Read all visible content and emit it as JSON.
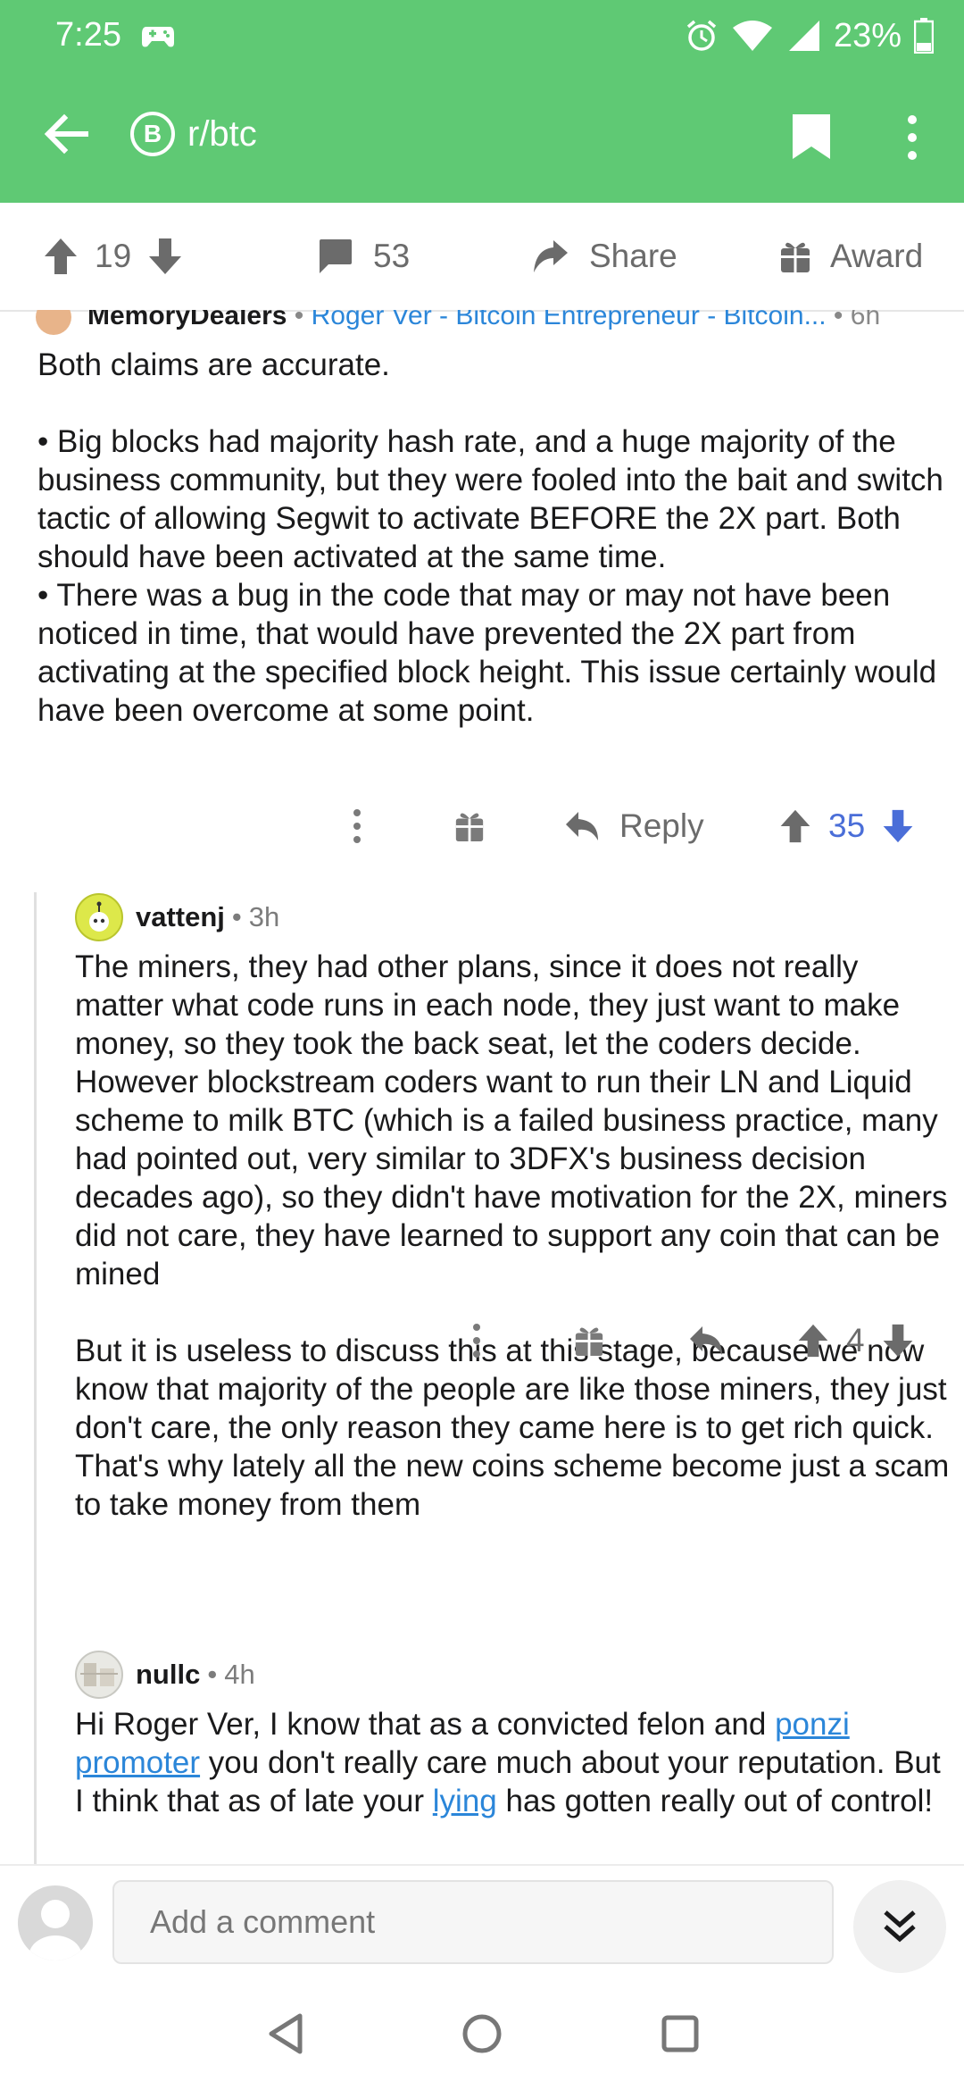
{
  "status_bar": {
    "time": "7:25",
    "battery": "23%"
  },
  "app_bar": {
    "subreddit": "r/btc",
    "subreddit_icon_letter": "B",
    "brand_color": "#5fc974"
  },
  "vote_bar": {
    "score": "19",
    "comments": "53",
    "share_label": "Share",
    "award_label": "Award"
  },
  "comment_parent": {
    "author": "MemoryDealers",
    "flair": "Roger Ver - Bitcoin Entrepreneur - Bitcoin...",
    "age": "6h",
    "paragraphs": [
      "Both claims are accurate.",
      "• Big blocks had majority hash rate, and a huge majority of the business community, but they were fooled into the bait and switch tactic of allowing Segwit to activate BEFORE the 2X part.  Both should have been activated at the same time.",
      "• There was a bug in the code that may or may not have been noticed in time, that would have prevented the 2X part from activating at the specified block height.  This issue certainly would have been overcome at some point."
    ],
    "reply_label": "Reply",
    "score": "35"
  },
  "comment_vattenj": {
    "author": "vattenj",
    "age": "3h",
    "paragraphs": [
      "The miners, they had other plans, since it does not really matter what code runs in each node, they just want to make money, so they took the back seat, let the coders decide. However blockstream coders want to run their LN and Liquid scheme to milk BTC (which is a failed business practice, many had pointed out, very similar to 3DFX's business decision decades ago), so they didn't have motivation for the 2X, miners did not care, they have learned to support any coin that can be mined",
      "But it is useless to discuss this at this stage, because we now know that majority of the people are like those miners, they just don't care, the only reason they came here is to get rich quick. That's why lately all the new coins scheme become just a scam to take money from them"
    ],
    "score": "4"
  },
  "comment_nullc": {
    "author": "nullc",
    "age": "4h",
    "text_1": "Hi Roger Ver,  I know that as a convicted felon and ",
    "link_1": "ponzi promoter",
    "text_2": " you don't really care much about your reputation. But I think that as of late your ",
    "link_2": "lying",
    "text_3": " has gotten really out of control!"
  },
  "composer": {
    "placeholder": "Add a comment"
  },
  "icons": [
    "back-arrow-icon",
    "bitcoin-icon",
    "bookmark-icon",
    "more-vert-icon",
    "upvote-icon",
    "downvote-icon",
    "comment-icon",
    "share-icon",
    "gift-icon",
    "reply-icon",
    "collapse-icon",
    "nav-back-icon",
    "nav-home-icon",
    "nav-recents-icon"
  ]
}
